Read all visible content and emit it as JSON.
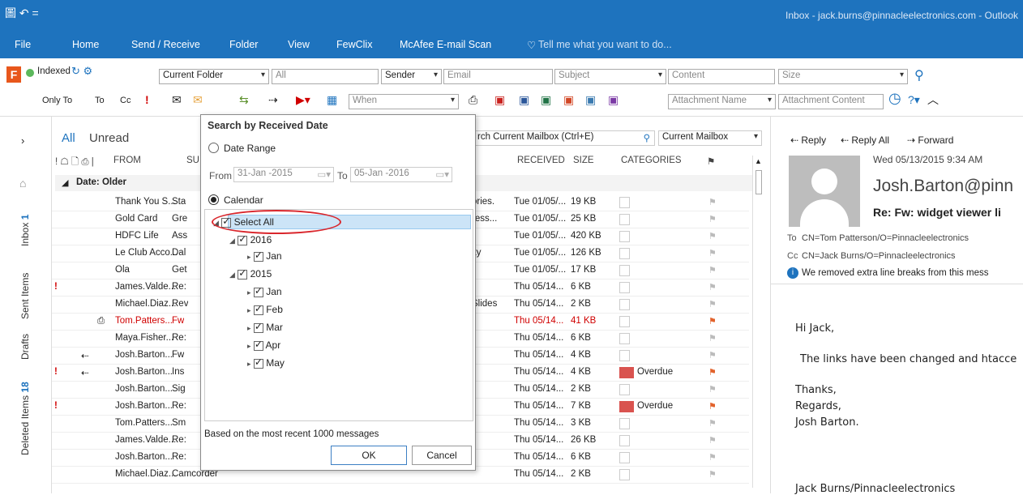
{
  "title": {
    "window_title": "Inbox - jack.burns@pinnacleelectronics.com - Outlook",
    "quick_access": "圖 ↶ ="
  },
  "tabs": [
    "File",
    "Home",
    "Send / Receive",
    "Folder",
    "View",
    "FewClix",
    "McAfee E-mail Scan",
    "Tell me what you want to do..."
  ],
  "search": {
    "indexed": "Indexed",
    "scope": "Current Folder",
    "all": "All",
    "sender": "Sender",
    "email": "Email",
    "subject": "Subject",
    "content": "Content",
    "size": "Size",
    "only_to": "Only To",
    "to": "To",
    "cc": "Cc",
    "when": "When",
    "attachment_name": "Attachment Name",
    "attachment_content": "Attachment Content"
  },
  "leftnav": {
    "inbox": "Inbox",
    "inbox_count": "1",
    "sent": "Sent Items",
    "drafts": "Drafts",
    "deleted": "Deleted Items",
    "deleted_count": "18"
  },
  "list": {
    "filter_all": "All",
    "filter_unread": "Unread",
    "search_placeholder": "rch Current Mailbox (Ctrl+E)",
    "search_scope": "Current Mailbox",
    "col_from": "FROM",
    "col_subject": "SU",
    "col_received": "RECEIVED",
    "col_size": "SIZE",
    "col_categories": "CATEGORIES",
    "group": "Date: Older",
    "rows": [
      {
        "from": "Thank You S...",
        "subj": "Sta",
        "extra": "ories.",
        "received": "Tue 01/05/...",
        "size": "19 KB",
        "cat": ""
      },
      {
        "from": "Gold Card",
        "subj": "Gre",
        "extra": "ress...",
        "received": "Tue 01/05/...",
        "size": "25 KB",
        "cat": ""
      },
      {
        "from": "HDFC Life",
        "subj": "Ass",
        "extra": "",
        "received": "Tue 01/05/...",
        "size": "420 KB",
        "cat": ""
      },
      {
        "from": "Le Club Acco...",
        "subj": "Dal",
        "extra": "ity",
        "received": "Tue 01/05/...",
        "size": "126 KB",
        "cat": ""
      },
      {
        "from": "Ola",
        "subj": "Get",
        "extra": "",
        "received": "Tue 01/05/...",
        "size": "17 KB",
        "cat": ""
      },
      {
        "from": "James.Valde...",
        "subj": "Re:",
        "extra": "",
        "received": "Thu 05/14...",
        "size": "6 KB",
        "cat": ""
      },
      {
        "from": "Michael.Diaz...",
        "subj": "Rev",
        "extra": "Slides",
        "received": "Thu 05/14...",
        "size": "2 KB",
        "cat": ""
      },
      {
        "from": "Tom.Patters...",
        "subj": "Fw",
        "extra": "",
        "received": "Thu 05/14...",
        "size": "41 KB",
        "cat": ""
      },
      {
        "from": "Maya.Fisher...",
        "subj": "Re:",
        "extra": "",
        "received": "Thu 05/14...",
        "size": "6 KB",
        "cat": ""
      },
      {
        "from": "Josh.Barton...",
        "subj": "Fw",
        "extra": "",
        "received": "Thu 05/14...",
        "size": "4 KB",
        "cat": ""
      },
      {
        "from": "Josh.Barton...",
        "subj": "Ins",
        "extra": "",
        "received": "Thu 05/14...",
        "size": "4 KB",
        "cat": "Overdue"
      },
      {
        "from": "Josh.Barton...",
        "subj": "Sig",
        "extra": "",
        "received": "Thu 05/14...",
        "size": "2 KB",
        "cat": ""
      },
      {
        "from": "Josh.Barton...",
        "subj": "Re:",
        "extra": "",
        "received": "Thu 05/14...",
        "size": "7 KB",
        "cat": "Overdue"
      },
      {
        "from": "Tom.Patters...",
        "subj": "Sm",
        "extra": "",
        "received": "Thu 05/14...",
        "size": "3 KB",
        "cat": ""
      },
      {
        "from": "James.Valde...",
        "subj": "Re:",
        "extra": "",
        "received": "Thu 05/14...",
        "size": "26 KB",
        "cat": ""
      },
      {
        "from": "Josh.Barton...",
        "subj": "Re:",
        "extra": "",
        "received": "Thu 05/14...",
        "size": "6 KB",
        "cat": ""
      },
      {
        "from": "Michael.Diaz...",
        "subj": "Camcorder",
        "extra": "",
        "received": "Thu 05/14...",
        "size": "2 KB",
        "cat": ""
      }
    ]
  },
  "panel": {
    "title": "Search by Received Date",
    "date_range": "Date Range",
    "from_label": "From",
    "from_value": "31-Jan -2015",
    "to_label": "To",
    "to_value": "05-Jan -2016",
    "calendar": "Calendar",
    "select_all": "Select All",
    "y2016": "2016",
    "jan2016": "Jan",
    "y2015": "2015",
    "m1": "Jan",
    "m2": "Feb",
    "m3": "Mar",
    "m4": "Apr",
    "m5": "May",
    "footer": "Based on the most recent 1000 messages",
    "ok": "OK",
    "cancel": "Cancel"
  },
  "reading": {
    "reply": "Reply",
    "reply_all": "Reply All",
    "forward": "Forward",
    "date": "Wed 05/13/2015 9:34 AM",
    "sender": "Josh.Barton@pinn",
    "subject": "Re: Fw: widget viewer li",
    "to_label": "To",
    "to": "CN=Tom Patterson/O=Pinnacleelectronics",
    "cc_label": "Cc",
    "cc": "CN=Jack Burns/O=Pinnacleelectronics",
    "info": "We removed extra line breaks from this mess",
    "body1": "Hi Jack,",
    "body2": "The links have been changed and htacce",
    "body3": "Thanks,",
    "body4": "Regards,",
    "body5": "Josh Barton.",
    "signature": "Jack Burns/Pinnacleelectronics"
  },
  "colors": {
    "accent": "#1e73be",
    "overdue": "#d9534f",
    "highlight": "#cce4f7",
    "red_text": "#d00000"
  }
}
